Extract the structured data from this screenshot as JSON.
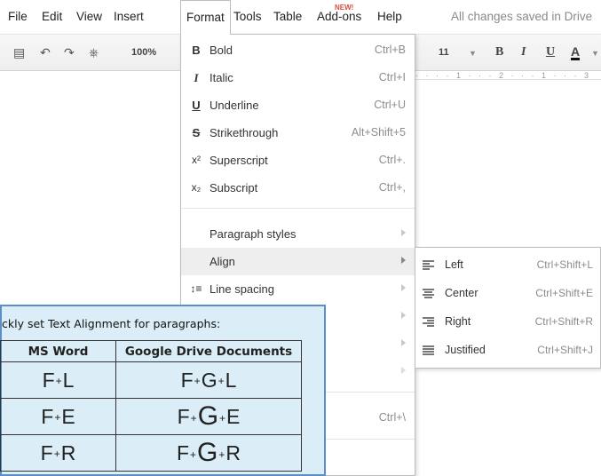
{
  "menubar": {
    "items": [
      "File",
      "Edit",
      "View",
      "Insert",
      "Format",
      "Tools",
      "Table",
      "Add-ons",
      "Help"
    ],
    "new_badge": "NEW!",
    "status": "All changes saved in Drive"
  },
  "toolbar": {
    "zoom": "100%",
    "font_size": "11",
    "bold": "B",
    "italic": "I",
    "underline": "U",
    "text_color": "A"
  },
  "ruler": {
    "text": "· · · · 1 · · · 2 · · · 1 · · · 3"
  },
  "format_menu": {
    "items": [
      {
        "icon": "bold-icon",
        "glyph": "B",
        "label": "Bold",
        "shortcut": "Ctrl+B"
      },
      {
        "icon": "italic-icon",
        "glyph": "I",
        "label": "Italic",
        "shortcut": "Ctrl+I"
      },
      {
        "icon": "underline-icon",
        "glyph": "U",
        "label": "Underline",
        "shortcut": "Ctrl+U"
      },
      {
        "icon": "strikethrough-icon",
        "glyph": "S",
        "label": "Strikethrough",
        "shortcut": "Alt+Shift+5"
      },
      {
        "icon": "superscript-icon",
        "glyph": "x²",
        "label": "Superscript",
        "shortcut": "Ctrl+."
      },
      {
        "icon": "subscript-icon",
        "glyph": "x₂",
        "label": "Subscript",
        "shortcut": "Ctrl+,"
      },
      {
        "label": "Paragraph styles"
      },
      {
        "label": "Align"
      },
      {
        "icon": "line-spacing-icon",
        "label": "Line spacing"
      },
      {
        "shortcut": "Ctrl+\\"
      }
    ]
  },
  "align_menu": {
    "items": [
      {
        "label": "Left",
        "shortcut": "Ctrl+Shift+L"
      },
      {
        "label": "Center",
        "shortcut": "Ctrl+Shift+E"
      },
      {
        "label": "Right",
        "shortcut": "Ctrl+Shift+R"
      },
      {
        "label": "Justified",
        "shortcut": "Ctrl+Shift+J"
      }
    ]
  },
  "overlay": {
    "caption": "ckly set Text Alignment for paragraphs:",
    "headers": [
      "MS Word",
      "Google Drive Documents"
    ],
    "rows": [
      {
        "word": [
          "F",
          "L"
        ],
        "drive": [
          "F",
          "G",
          "L"
        ]
      },
      {
        "word": [
          "F",
          "E"
        ],
        "drive": [
          "F",
          "G",
          "E"
        ]
      },
      {
        "word": [
          "F",
          "R"
        ],
        "drive": [
          "F",
          "G",
          "R"
        ]
      }
    ],
    "plus": "+"
  },
  "colors": {
    "overlay_bg": "#dbedf6",
    "overlay_border": "#5b8fc7",
    "new_badge": "#dd4b39"
  }
}
